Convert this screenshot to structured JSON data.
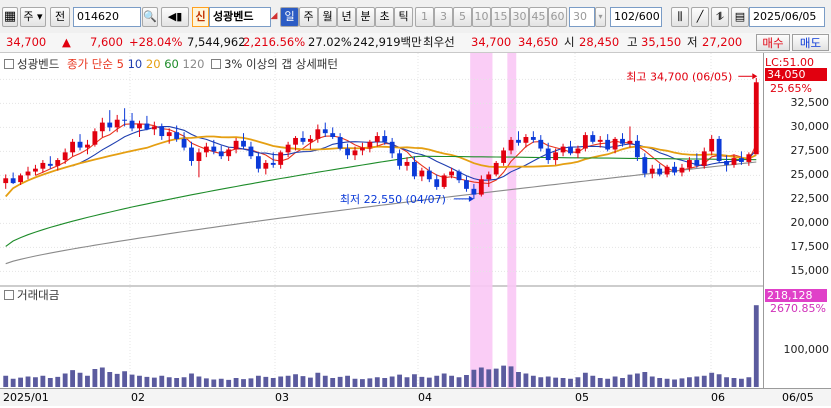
{
  "toolbar": {
    "market_label": "주",
    "full_button": "전",
    "stock_code": "014620",
    "badge_sin": "신",
    "stock_name": "성광벤드",
    "periods": [
      "일",
      "주",
      "월",
      "년",
      "분",
      "초",
      "틱"
    ],
    "active_period": "일",
    "intervals": [
      "1",
      "3",
      "5",
      "10",
      "15",
      "30",
      "45",
      "60"
    ],
    "interval_value": "30",
    "count_value": "102",
    "count_total": "/600",
    "date_value": "2025/06/05"
  },
  "quote": {
    "price": "34,700",
    "change": "7,600",
    "change_pct": "+28.04%",
    "volume": "7,544,962",
    "volume_pct": "2,216.56%",
    "turnover": "27.02%",
    "amount": "242,919백만",
    "best_ask_label": "최우선",
    "best_ask": "34,700",
    "best_bid": "34,650",
    "open_label": "시",
    "open": "28,450",
    "high_label": "고",
    "high": "35,150",
    "low_label": "저",
    "low": "27,200",
    "buy_button": "매수",
    "sell_button": "매도"
  },
  "legend": {
    "name": "성광벤드",
    "ma_label": "종가 단순",
    "ma_periods": [
      "5",
      "10",
      "20",
      "60",
      "120"
    ],
    "ma_colors": [
      "#e8341d",
      "#1f3fb0",
      "#e59f12",
      "#1e8c2a",
      "#8a8a8a"
    ],
    "pattern_label": "3% 이상의 갭 상세패턴",
    "volume_label": "거래대금"
  },
  "annotations": {
    "high_label": "최고 34,700 (06/05)",
    "low_label": "최저 22,550 (04/07)",
    "lc_label": "LC:51.00",
    "last_price_badge": "34,050",
    "last_change_badge": "25.65%",
    "vol_badge": "218,128",
    "vol_pct_badge": "2670.85%"
  },
  "colors": {
    "up": "#e1000f",
    "down": "#0b3ad8",
    "gap_highlight": "#f9c8f5",
    "volume_bar": "#5b5b9e"
  },
  "chart_data": {
    "type": "candlestick",
    "y_ticks": [
      "35,000",
      "32,500",
      "30,000",
      "27,500",
      "25,000",
      "22,500",
      "20,000",
      "17,500",
      "15,000"
    ],
    "vol_ticks": [
      "100,000"
    ],
    "x_labels": [
      "2025/01",
      "02",
      "03",
      "04",
      "05",
      "06",
      "06/05"
    ],
    "price_range": [
      14000,
      36500
    ],
    "volume_max": 240000,
    "candles": [
      [
        24200,
        25100,
        23600,
        24700,
        30000
      ],
      [
        24700,
        25300,
        24100,
        24200,
        22000
      ],
      [
        24300,
        25200,
        24000,
        25000,
        25000
      ],
      [
        25000,
        25900,
        24600,
        25400,
        28000
      ],
      [
        25400,
        26100,
        25000,
        25700,
        26000
      ],
      [
        25700,
        26600,
        25300,
        26300,
        30000
      ],
      [
        26200,
        27000,
        25700,
        26000,
        24000
      ],
      [
        26000,
        26800,
        25500,
        26600,
        27000
      ],
      [
        26600,
        27800,
        26200,
        27400,
        36000
      ],
      [
        27400,
        28800,
        27000,
        28500,
        45000
      ],
      [
        28500,
        29300,
        27600,
        27900,
        38000
      ],
      [
        27900,
        28700,
        27200,
        28200,
        30000
      ],
      [
        28200,
        29900,
        28000,
        29600,
        48000
      ],
      [
        29600,
        31000,
        29000,
        30500,
        52000
      ],
      [
        30500,
        31800,
        29600,
        30000,
        40000
      ],
      [
        30000,
        31300,
        29500,
        30800,
        35000
      ],
      [
        30800,
        32000,
        30100,
        30700,
        42000
      ],
      [
        30700,
        31500,
        29600,
        29900,
        33000
      ],
      [
        29900,
        30700,
        29000,
        30400,
        30000
      ],
      [
        30400,
        31200,
        29700,
        29800,
        27000
      ],
      [
        29800,
        30600,
        29200,
        30100,
        25000
      ],
      [
        30100,
        30400,
        28700,
        29100,
        30000
      ],
      [
        29100,
        29900,
        28300,
        29500,
        26000
      ],
      [
        29500,
        30200,
        28500,
        28800,
        24000
      ],
      [
        28800,
        29500,
        27600,
        27900,
        26000
      ],
      [
        27900,
        28500,
        26000,
        26500,
        36000
      ],
      [
        26500,
        27800,
        24800,
        27400,
        28000
      ],
      [
        27400,
        28400,
        26900,
        28000,
        23000
      ],
      [
        28000,
        28700,
        27200,
        27500,
        20000
      ],
      [
        27500,
        28100,
        26700,
        27000,
        22000
      ],
      [
        27000,
        27900,
        26500,
        27700,
        19000
      ],
      [
        27700,
        28900,
        27300,
        28600,
        24000
      ],
      [
        28600,
        29400,
        27800,
        28000,
        21000
      ],
      [
        28000,
        28500,
        26700,
        27000,
        23000
      ],
      [
        27000,
        27400,
        25300,
        25700,
        30000
      ],
      [
        25700,
        26600,
        25100,
        26300,
        27000
      ],
      [
        26300,
        27400,
        25800,
        26100,
        24000
      ],
      [
        26100,
        27600,
        25700,
        27400,
        28000
      ],
      [
        27400,
        28500,
        26900,
        28200,
        30000
      ],
      [
        28200,
        29100,
        27600,
        28900,
        34000
      ],
      [
        28900,
        29600,
        28200,
        28500,
        29000
      ],
      [
        28500,
        29200,
        27700,
        28800,
        25000
      ],
      [
        28800,
        30300,
        28400,
        29800,
        38000
      ],
      [
        29800,
        30500,
        29000,
        29400,
        30000
      ],
      [
        29400,
        30000,
        28800,
        29000,
        24000
      ],
      [
        29000,
        29400,
        27600,
        27800,
        27000
      ],
      [
        27800,
        28300,
        26700,
        27100,
        30000
      ],
      [
        27100,
        28000,
        26600,
        27600,
        22000
      ],
      [
        27600,
        28400,
        27100,
        27900,
        21000
      ],
      [
        27900,
        28700,
        27400,
        28500,
        23000
      ],
      [
        28500,
        29500,
        28000,
        29100,
        26000
      ],
      [
        29100,
        29700,
        28200,
        28500,
        24000
      ],
      [
        28500,
        28900,
        26800,
        27300,
        28000
      ],
      [
        27300,
        27700,
        25600,
        26000,
        33000
      ],
      [
        26000,
        26900,
        25500,
        26400,
        26000
      ],
      [
        26400,
        27000,
        24600,
        24900,
        34000
      ],
      [
        24900,
        25800,
        24400,
        25500,
        27000
      ],
      [
        25500,
        25900,
        24300,
        24600,
        25000
      ],
      [
        24600,
        25100,
        23500,
        23800,
        30000
      ],
      [
        23800,
        25200,
        23600,
        25000,
        36000
      ],
      [
        25000,
        25800,
        24700,
        25400,
        30000
      ],
      [
        25400,
        25600,
        24200,
        24500,
        26000
      ],
      [
        24500,
        24900,
        23300,
        23600,
        32000
      ],
      [
        23600,
        24100,
        22550,
        23000,
        46000
      ],
      [
        23000,
        25000,
        22800,
        24600,
        52000
      ],
      [
        24600,
        25400,
        23800,
        25100,
        47000
      ],
      [
        25100,
        26500,
        24900,
        26300,
        49000
      ],
      [
        26300,
        27900,
        26000,
        27600,
        57000
      ],
      [
        27600,
        29000,
        27200,
        28700,
        55000
      ],
      [
        28700,
        29600,
        28100,
        28400,
        40000
      ],
      [
        28400,
        29300,
        27900,
        29000,
        36000
      ],
      [
        29000,
        29600,
        28400,
        28700,
        30000
      ],
      [
        28700,
        29200,
        27500,
        27800,
        26000
      ],
      [
        27800,
        28400,
        26200,
        26600,
        28000
      ],
      [
        26600,
        27800,
        26100,
        27400,
        25000
      ],
      [
        27400,
        28300,
        27000,
        28000,
        24000
      ],
      [
        28000,
        28600,
        27100,
        27300,
        22000
      ],
      [
        27300,
        28100,
        26800,
        27800,
        26000
      ],
      [
        27800,
        29500,
        27500,
        29200,
        38000
      ],
      [
        29200,
        29600,
        28300,
        28500,
        30000
      ],
      [
        28500,
        29100,
        27900,
        28700,
        24000
      ],
      [
        28700,
        29300,
        27500,
        27700,
        22000
      ],
      [
        27700,
        29000,
        27300,
        28800,
        28000
      ],
      [
        28800,
        29400,
        28000,
        28300,
        24000
      ],
      [
        28300,
        30100,
        27900,
        28600,
        33000
      ],
      [
        28600,
        29200,
        26500,
        26900,
        36000
      ],
      [
        26900,
        27300,
        24800,
        25200,
        40000
      ],
      [
        25200,
        26100,
        24700,
        25700,
        28000
      ],
      [
        25700,
        26200,
        24900,
        25100,
        24000
      ],
      [
        25100,
        26100,
        24800,
        25900,
        22000
      ],
      [
        25900,
        26400,
        25000,
        25300,
        20000
      ],
      [
        25300,
        26200,
        24900,
        25800,
        23000
      ],
      [
        25800,
        26900,
        25400,
        26600,
        26000
      ],
      [
        26600,
        27300,
        25800,
        26000,
        28000
      ],
      [
        26000,
        27900,
        25700,
        27500,
        30000
      ],
      [
        27500,
        29200,
        27100,
        28800,
        38000
      ],
      [
        28800,
        29100,
        26300,
        26500,
        34000
      ],
      [
        26500,
        27100,
        25400,
        26100,
        26000
      ],
      [
        26100,
        27200,
        25800,
        26800,
        24000
      ],
      [
        26800,
        27500,
        26100,
        26400,
        22000
      ],
      [
        26400,
        27400,
        26000,
        27200,
        26000
      ],
      [
        27200,
        35150,
        27200,
        34700,
        218128
      ]
    ],
    "gap_highlight_index": [
      63,
      68
    ]
  }
}
